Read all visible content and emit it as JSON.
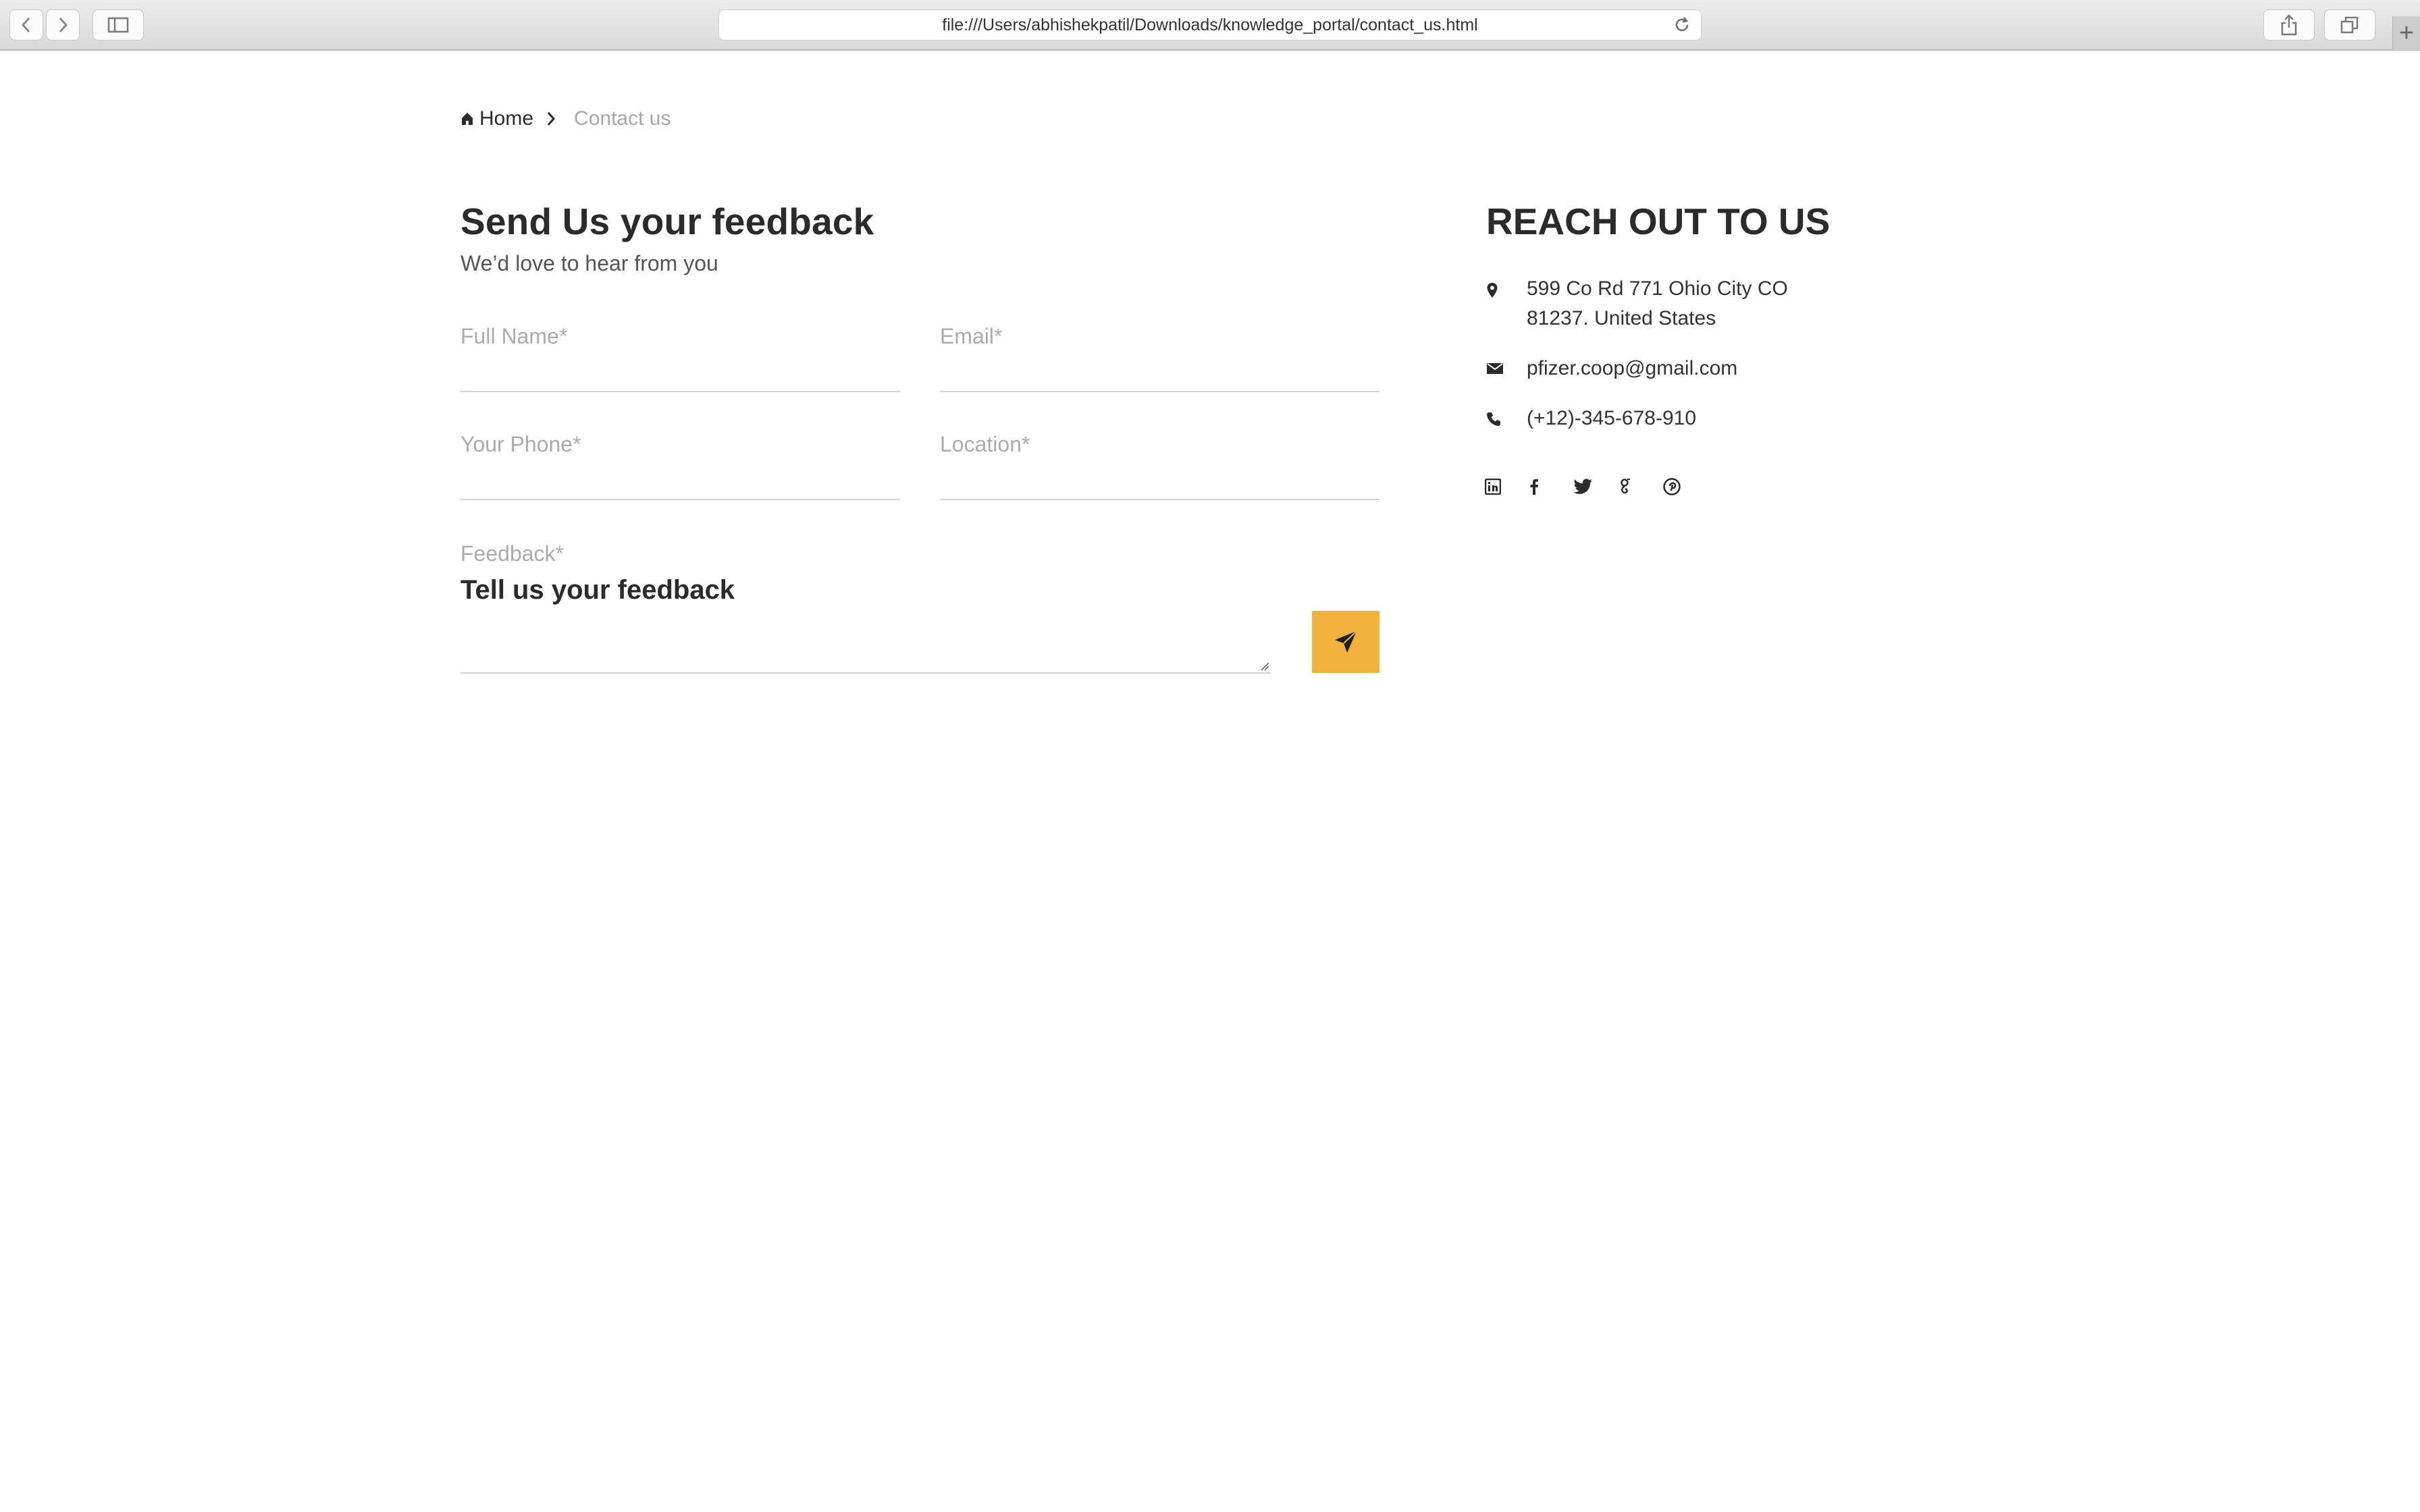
{
  "browser": {
    "url": "file:///Users/abhishekpatil/Downloads/knowledge_portal/contact_us.html",
    "new_tab": "+"
  },
  "breadcrumb": {
    "home_label": "Home",
    "current_label": "Contact us"
  },
  "form": {
    "title": "Send Us your feedback",
    "subtitle": "We’d love to hear from you",
    "full_name_label": "Full Name*",
    "full_name_value": "",
    "email_label": "Email*",
    "email_value": "",
    "phone_label": "Your Phone*",
    "phone_value": "",
    "location_label": "Location*",
    "location_value": "",
    "feedback_label": "Feedback*",
    "feedback_placeholder": "Tell us your feedback",
    "send_icon": "send-icon",
    "send_color": "#f0b23d"
  },
  "contact": {
    "title": "REACH OUT TO US",
    "address_line1": "599 Co Rd 771 Ohio City CO",
    "address_line2": "81237. United States",
    "email": "pfizer.coop@gmail.com",
    "phone": "(+12)-345-678-910",
    "socials": [
      "linkedin-icon",
      "facebook-icon",
      "twitter-icon",
      "google-plus-icon",
      "pinterest-icon"
    ]
  }
}
